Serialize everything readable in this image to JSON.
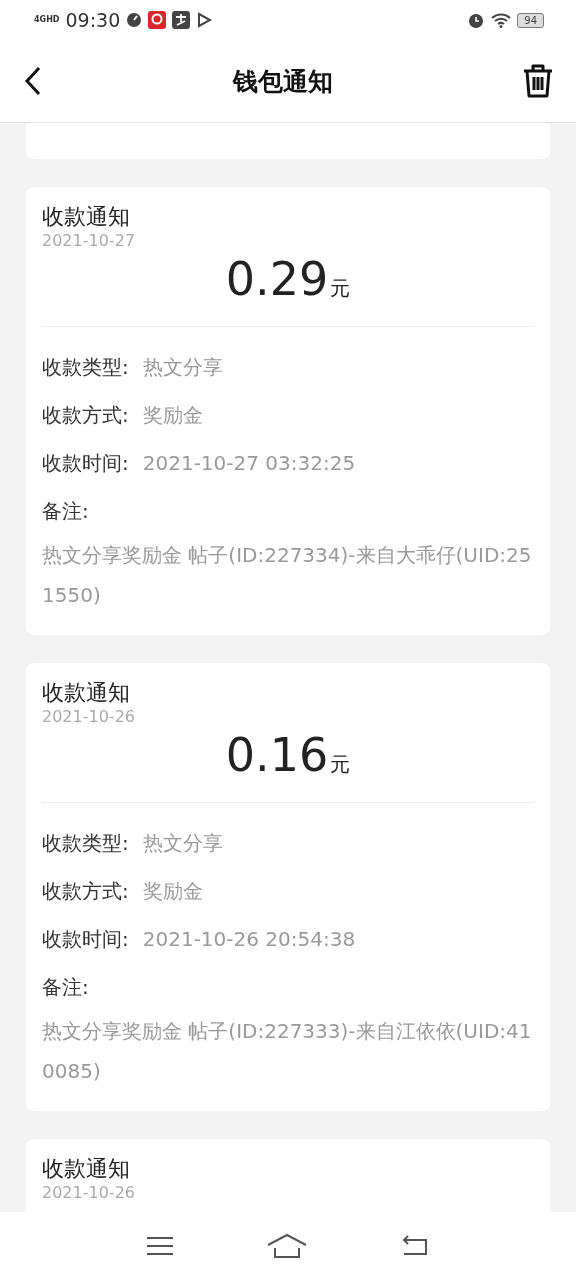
{
  "status_bar": {
    "network": "4GHD",
    "time": "09:30",
    "battery": "94"
  },
  "header": {
    "title": "钱包通知"
  },
  "notices": [
    {
      "title": "收款通知",
      "date": "2021-10-27",
      "amount": "0.29",
      "unit": "元",
      "fields": [
        {
          "label": "收款类型:",
          "value": "热文分享"
        },
        {
          "label": "收款方式:",
          "value": "奖励金"
        },
        {
          "label": "收款时间:",
          "value": "2021-10-27 03:32:25"
        }
      ],
      "remark_label": "备注:",
      "remark": "热文分享奖励金 帖子(ID:227334)-来自大乖仔(UID:251550)"
    },
    {
      "title": "收款通知",
      "date": "2021-10-26",
      "amount": "0.16",
      "unit": "元",
      "fields": [
        {
          "label": "收款类型:",
          "value": "热文分享"
        },
        {
          "label": "收款方式:",
          "value": "奖励金"
        },
        {
          "label": "收款时间:",
          "value": "2021-10-26 20:54:38"
        }
      ],
      "remark_label": "备注:",
      "remark": "热文分享奖励金 帖子(ID:227333)-来自江依依(UID:410085)"
    },
    {
      "title": "收款通知",
      "date": "2021-10-26"
    }
  ]
}
